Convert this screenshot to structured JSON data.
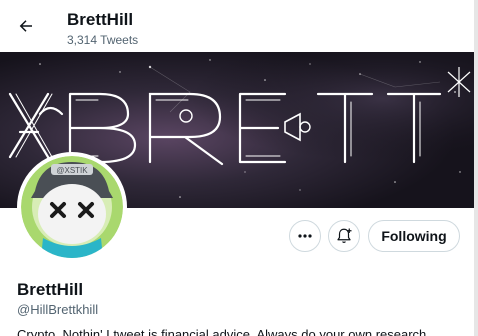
{
  "header": {
    "title": "BrettHill",
    "tweet_count": "3,314 Tweets"
  },
  "banner": {
    "text": "XBRETT",
    "colors": {
      "sky": "#201c28",
      "nebula": "#4a3a55",
      "letters": "#ffffff"
    }
  },
  "avatar": {
    "cap_text": "@XSTIK",
    "colors": {
      "ring": "#a9d86e",
      "cap": "#4a4f55",
      "face": "#f3f3f3",
      "mouth": "#2bb5c8"
    }
  },
  "actions": {
    "more_label": "•••",
    "following_label": "Following"
  },
  "profile": {
    "name": "BrettHill",
    "handle": "@HillBrettkhill",
    "bio": "Crypto. Nothin' I tweet is financial advice. Always do your own research."
  }
}
